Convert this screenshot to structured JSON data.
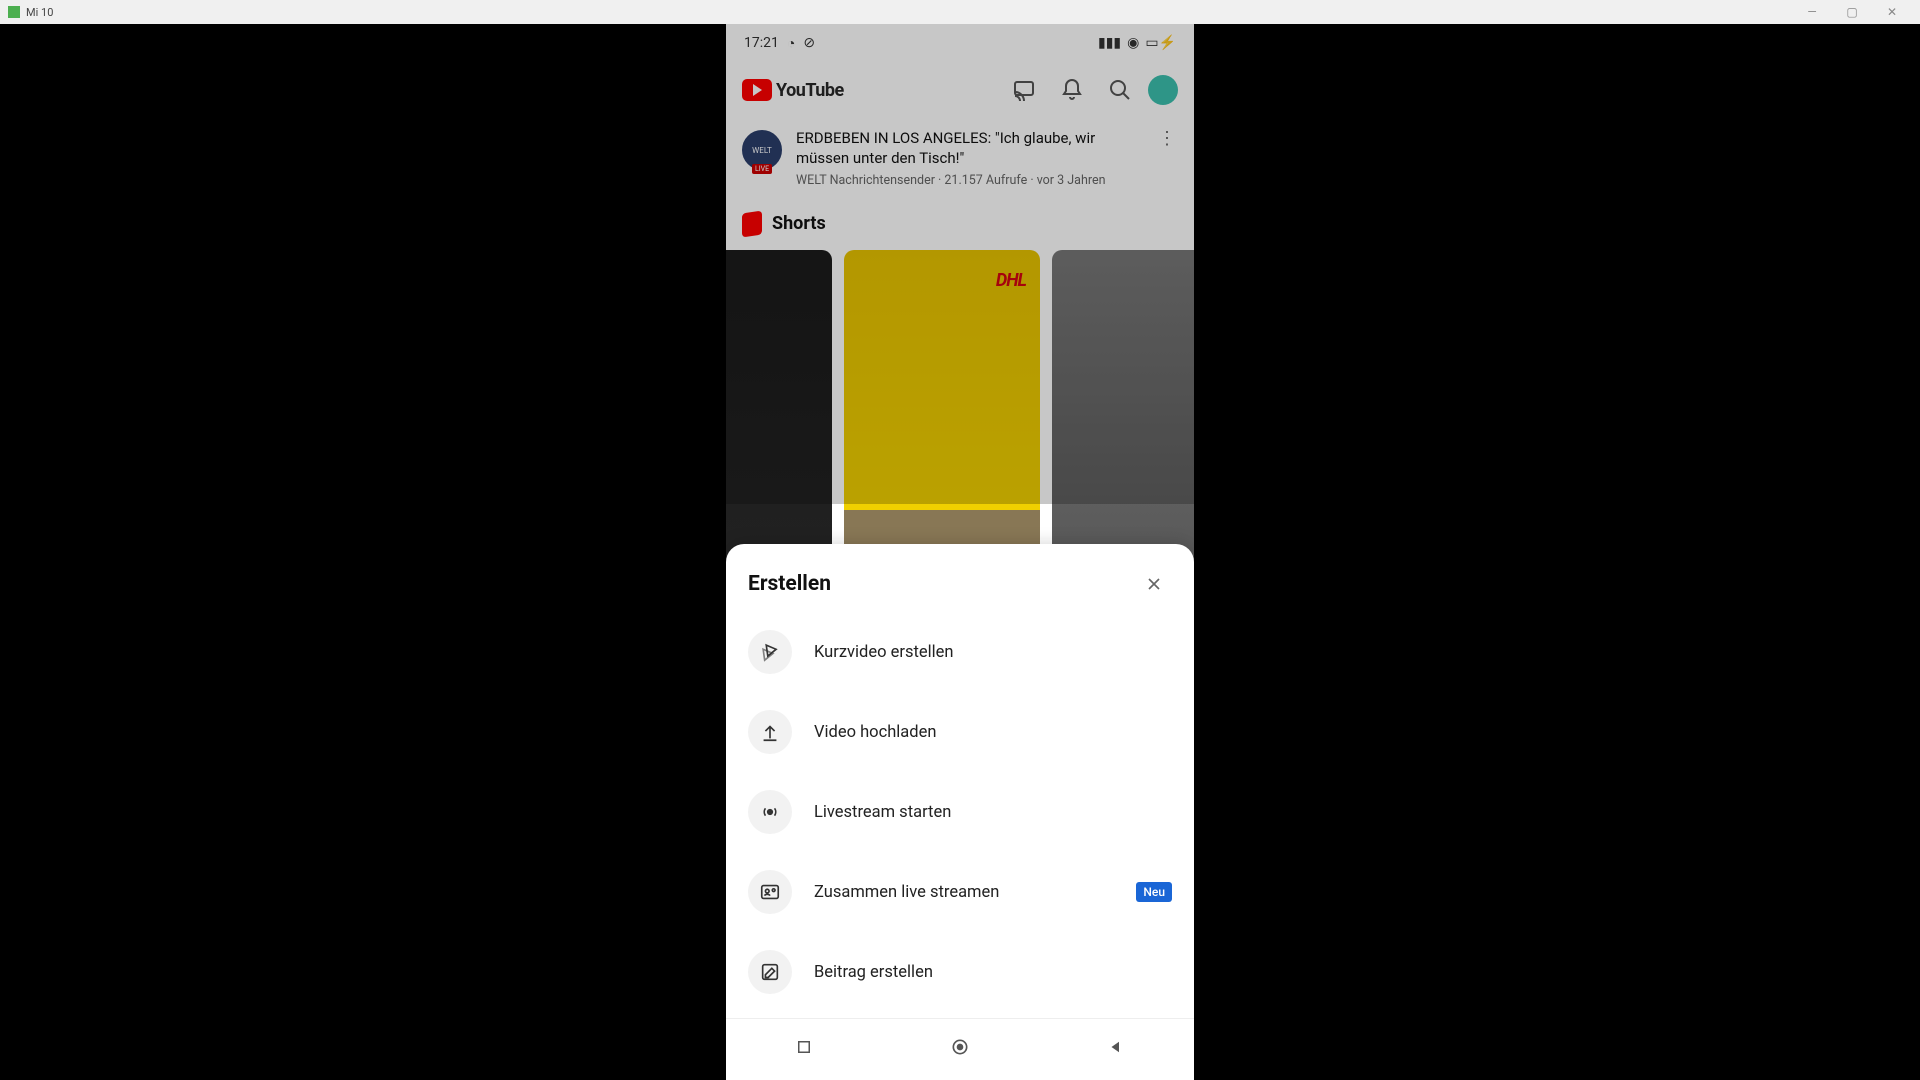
{
  "window": {
    "title": "Mi 10"
  },
  "status": {
    "time": "17:21"
  },
  "header": {
    "logo_text": "YouTube"
  },
  "feed": {
    "title": "ERDBEBEN IN LOS ANGELES: \"Ich glaube, wir müssen unter den Tisch!\"",
    "channel": "WELT Nachrichtensender",
    "views": "21.157 Aufrufe",
    "age": "vor 3 Jahren",
    "channel_badge": "WELT",
    "channel_live": "LIVE"
  },
  "shorts": {
    "title": "Shorts",
    "thumb2_brand": "DHL"
  },
  "sheet": {
    "title": "Erstellen",
    "options": [
      {
        "label": "Kurzvideo erstellen",
        "badge": null
      },
      {
        "label": "Video hochladen",
        "badge": null
      },
      {
        "label": "Livestream starten",
        "badge": null
      },
      {
        "label": "Zusammen live streamen",
        "badge": "Neu"
      },
      {
        "label": "Beitrag erstellen",
        "badge": null
      }
    ]
  }
}
